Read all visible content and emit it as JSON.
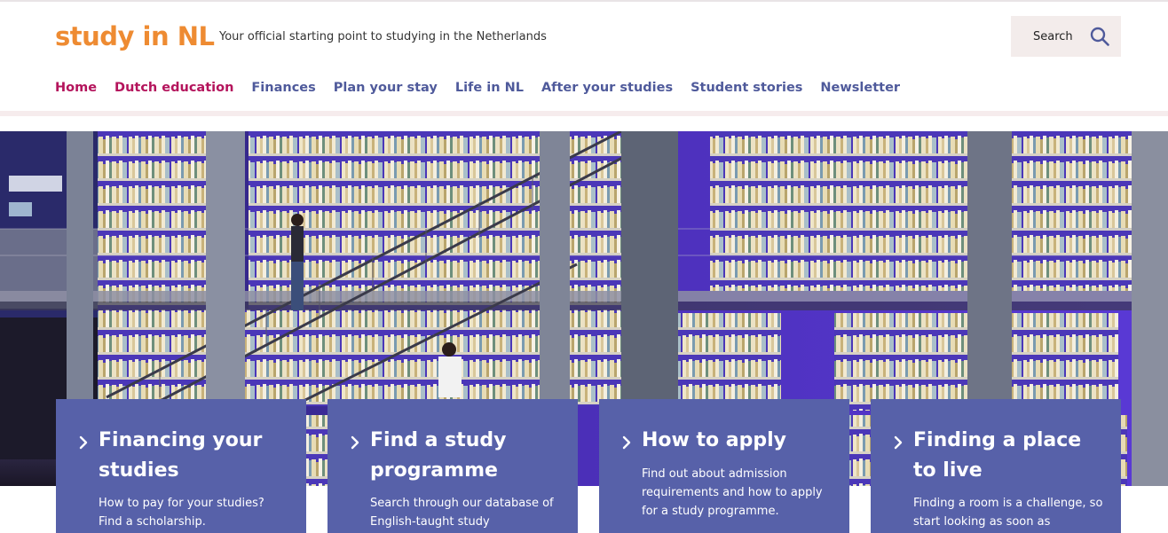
{
  "header": {
    "logo": "study in NL",
    "tagline": "Your official starting point to studying in the Netherlands",
    "search_label": "Search"
  },
  "nav": {
    "items": [
      {
        "label": "Home",
        "active": true
      },
      {
        "label": "Dutch education",
        "active": true
      },
      {
        "label": "Finances",
        "active": false
      },
      {
        "label": "Plan your stay",
        "active": false
      },
      {
        "label": "Life in NL",
        "active": false
      },
      {
        "label": "After your studies",
        "active": false
      },
      {
        "label": "Student stories",
        "active": false
      },
      {
        "label": "Newsletter",
        "active": false
      }
    ]
  },
  "hero": {
    "image": "library-bookshelves-staircase-photo"
  },
  "cards": [
    {
      "title": "Financing your studies",
      "description": "How to pay for your studies? Find a scholarship."
    },
    {
      "title": "Find a study programme",
      "description": "Search through our database of English-taught study"
    },
    {
      "title": "How to apply",
      "description": "Find out about admission requirements and how to apply for a study programme."
    },
    {
      "title": "Finding a place to live",
      "description": "Finding a room is a challenge, so start looking as soon as"
    }
  ],
  "colors": {
    "brand_orange": "#ee8b32",
    "nav_active": "#b4145c",
    "nav_default": "#4f5a9b",
    "card_bg": "#5761a9"
  }
}
